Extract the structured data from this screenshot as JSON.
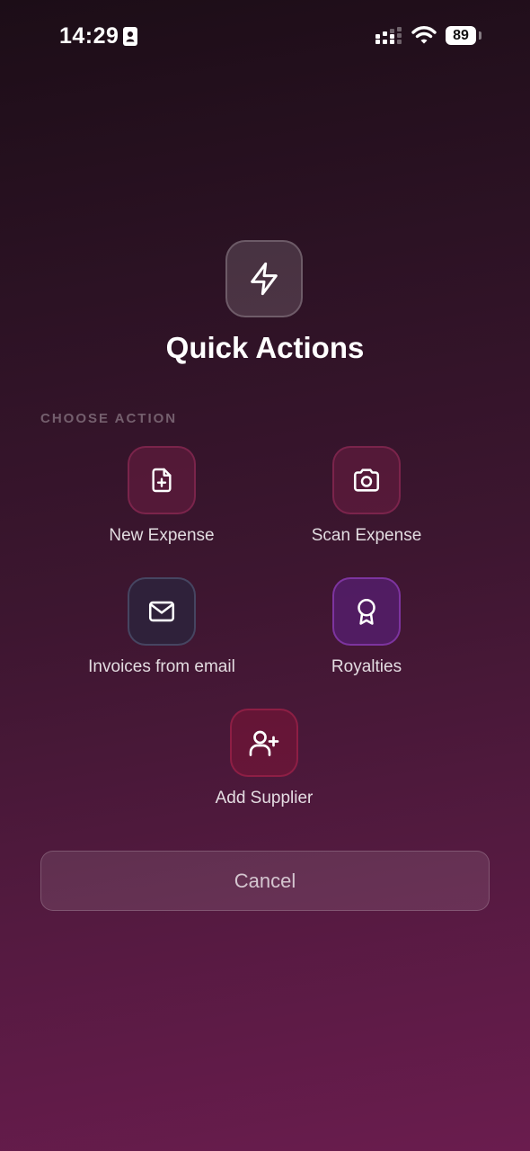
{
  "status_bar": {
    "time": "14:29",
    "battery": "89",
    "icons": [
      "id-card-icon",
      "signal-icon",
      "wifi-icon",
      "battery-icon"
    ]
  },
  "header": {
    "icon": "lightning-bolt-icon",
    "title": "Quick Actions"
  },
  "section_label": "CHOOSE ACTION",
  "actions": [
    {
      "label": "New Expense",
      "icon": "file-plus-icon",
      "color": "#7a1e46"
    },
    {
      "label": "Scan Expense",
      "icon": "camera-icon",
      "color": "#7a1e46"
    },
    {
      "label": "Invoices from email",
      "icon": "mail-icon",
      "color": "#2d233c"
    },
    {
      "label": "Royalties",
      "icon": "award-icon",
      "color": "#551e6e"
    },
    {
      "label": "Add Supplier",
      "icon": "user-plus-icon",
      "color": "#7d1437"
    }
  ],
  "cancel_label": "Cancel"
}
